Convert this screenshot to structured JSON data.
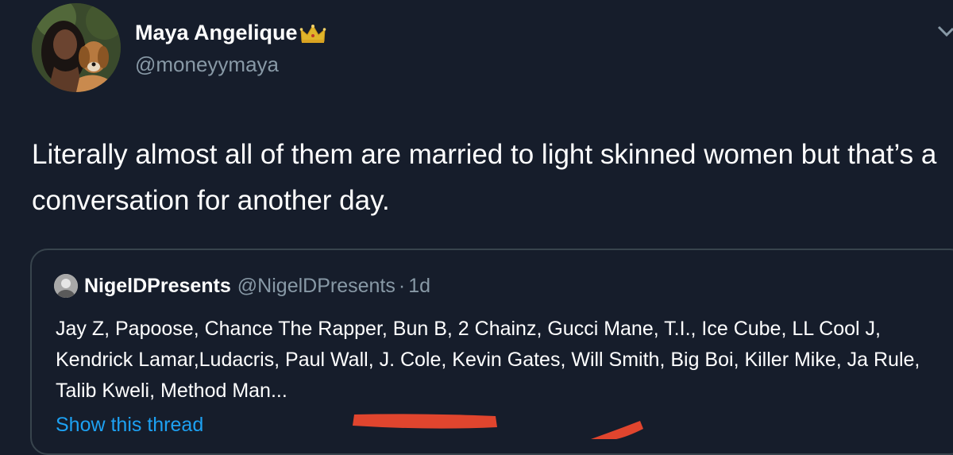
{
  "tweet": {
    "author_name": "Maya Angelique",
    "author_badge_icon": "crown-icon",
    "author_handle": "@moneyymaya",
    "text": "Literally almost all of them are married to light skinned women but that’s a conversation for another day."
  },
  "quoted_tweet": {
    "author_name": "NigelDPresents",
    "author_handle": "@NigelDPresents",
    "separator": "·",
    "time": "1d",
    "text": "Jay Z, Papoose, Chance The Rapper, Bun B, 2 Chainz, Gucci Mane, T.I., Ice Cube, LL Cool J, Kendrick Lamar,Ludacris, Paul Wall,  J. Cole, Kevin Gates, Will Smith, Big Boi, Killer Mike, Ja Rule, Talib Kweli, Method Man...",
    "show_thread_label": "Show this thread"
  },
  "colors": {
    "background": "#161d2b",
    "text_primary": "#ffffff",
    "text_secondary": "#8899a6",
    "link": "#1da1f2",
    "border": "#38444d",
    "annotation_marker": "#e0452e"
  }
}
